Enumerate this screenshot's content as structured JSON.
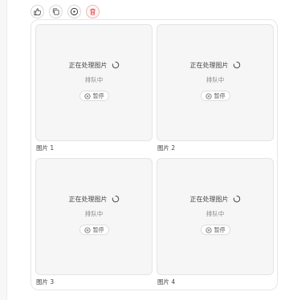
{
  "toolbar": {
    "buttons": [
      {
        "icon": "thumbs-up-icon"
      },
      {
        "icon": "copy-icon"
      },
      {
        "icon": "play-circle-icon"
      },
      {
        "icon": "trash-icon"
      }
    ]
  },
  "cards": [
    {
      "status": "正在处理图片",
      "queue": "排队中",
      "pause": "暂停",
      "caption": "图片 1"
    },
    {
      "status": "正在处理图片",
      "queue": "排队中",
      "pause": "暂停",
      "caption": "图片 2"
    },
    {
      "status": "正在处理图片",
      "queue": "排队中",
      "pause": "暂停",
      "caption": "图片 3"
    },
    {
      "status": "正在处理图片",
      "queue": "排队中",
      "pause": "暂停",
      "caption": "图片 4"
    }
  ],
  "colors": {
    "danger": "#e05555",
    "icon": "#555555",
    "card_bg": "#f6f6f7"
  }
}
